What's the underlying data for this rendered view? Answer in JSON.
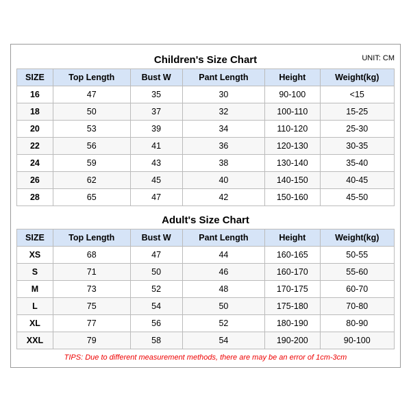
{
  "chart": {
    "unit": "UNIT: CM",
    "children": {
      "title": "Children's Size Chart",
      "headers": [
        "SIZE",
        "Top Length",
        "Bust W",
        "Pant Length",
        "Height",
        "Weight(kg)"
      ],
      "rows": [
        [
          "16",
          "47",
          "35",
          "30",
          "90-100",
          "<15"
        ],
        [
          "18",
          "50",
          "37",
          "32",
          "100-110",
          "15-25"
        ],
        [
          "20",
          "53",
          "39",
          "34",
          "110-120",
          "25-30"
        ],
        [
          "22",
          "56",
          "41",
          "36",
          "120-130",
          "30-35"
        ],
        [
          "24",
          "59",
          "43",
          "38",
          "130-140",
          "35-40"
        ],
        [
          "26",
          "62",
          "45",
          "40",
          "140-150",
          "40-45"
        ],
        [
          "28",
          "65",
          "47",
          "42",
          "150-160",
          "45-50"
        ]
      ]
    },
    "adults": {
      "title": "Adult's Size Chart",
      "headers": [
        "SIZE",
        "Top Length",
        "Bust W",
        "Pant Length",
        "Height",
        "Weight(kg)"
      ],
      "rows": [
        [
          "XS",
          "68",
          "47",
          "44",
          "160-165",
          "50-55"
        ],
        [
          "S",
          "71",
          "50",
          "46",
          "160-170",
          "55-60"
        ],
        [
          "M",
          "73",
          "52",
          "48",
          "170-175",
          "60-70"
        ],
        [
          "L",
          "75",
          "54",
          "50",
          "175-180",
          "70-80"
        ],
        [
          "XL",
          "77",
          "56",
          "52",
          "180-190",
          "80-90"
        ],
        [
          "XXL",
          "79",
          "58",
          "54",
          "190-200",
          "90-100"
        ]
      ]
    },
    "tips": "TIPS: Due to different measurement methods, there are may be an error of 1cm-3cm"
  }
}
